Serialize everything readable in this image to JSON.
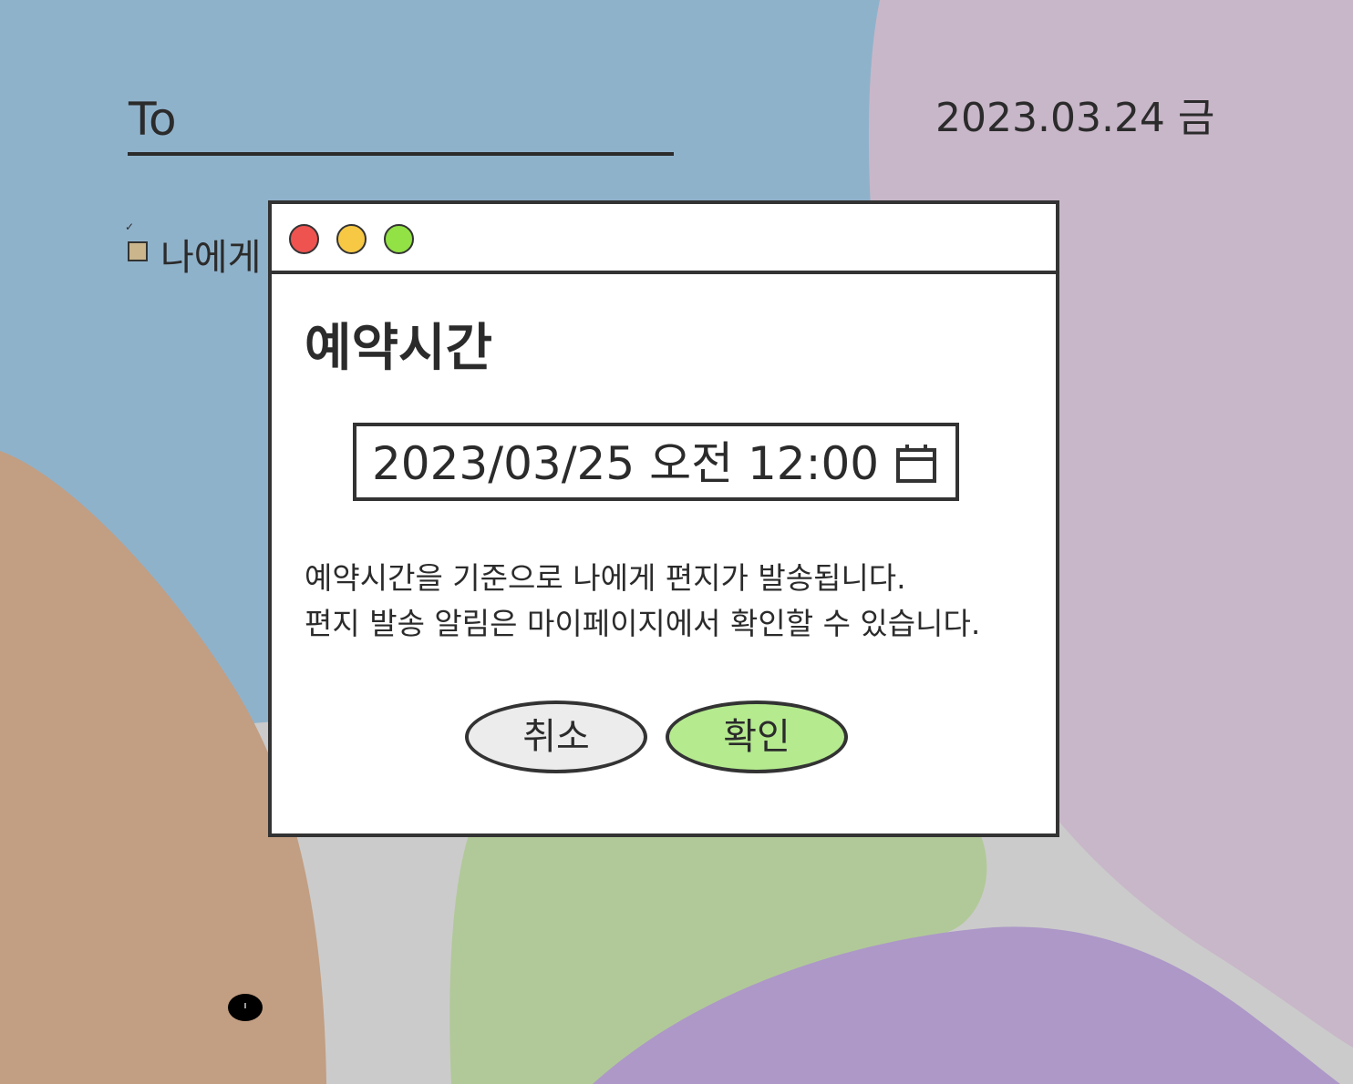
{
  "letter": {
    "to_label": "To",
    "date": "2023.03.24 금",
    "self_check_mark": "✓",
    "self_label": "나에게"
  },
  "dialog": {
    "title": "예약시간",
    "datetime_value": "2023/03/25 오전 12:00",
    "description_lines": [
      "예약시간을 기준으로 나에게 편지가 발송됩니다.",
      "편지 발송 알림은 마이페이지에서 확인할 수 있습니다."
    ],
    "cancel_label": "취소",
    "confirm_label": "확인"
  },
  "icons": {
    "window_controls": [
      "close-icon",
      "minimize-icon",
      "maximize-icon"
    ],
    "datetime_picker": "calendar-icon"
  },
  "colors": {
    "window_close": "#ee5350",
    "window_minimize": "#f7c844",
    "window_maximize": "#92e145",
    "confirm_button": "#b5ea8f",
    "cancel_button": "#ececec",
    "background_blue": "#8fb2cb",
    "background_pink": "#c8b7c8",
    "background_tan": "#c29e82",
    "background_green": "#b1c998",
    "background_purple": "#ad98c8",
    "outline": "#333333"
  }
}
